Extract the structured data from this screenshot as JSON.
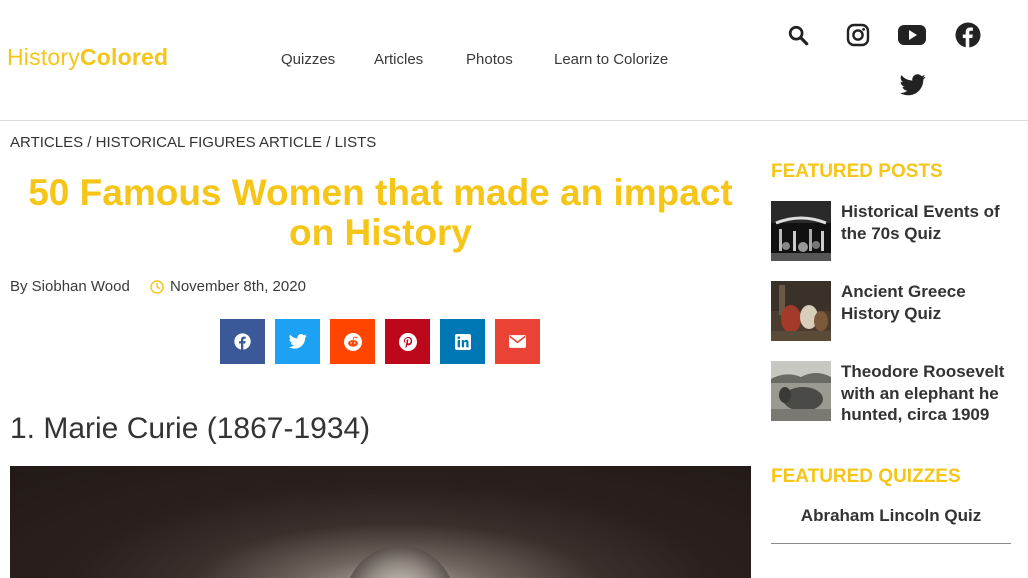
{
  "logo": {
    "part1": "History",
    "part2": "Colored"
  },
  "nav": {
    "items": [
      "Quizzes",
      "Articles",
      "Photos",
      "Learn to Colorize"
    ]
  },
  "header_icons": [
    "search-icon",
    "instagram-icon",
    "youtube-icon",
    "facebook-icon",
    "twitter-icon"
  ],
  "breadcrumb": {
    "items": [
      "Articles",
      "Historical Figures Article",
      "Lists"
    ],
    "separator": " / "
  },
  "article": {
    "title_line1": "50 Famous Women that made an impact",
    "title_line2": "on History",
    "author": "By Siobhan Wood",
    "date": "November 8th, 2020",
    "section_heading": "1. Marie Curie (1867-1934)"
  },
  "share": [
    {
      "icon": "facebook-icon",
      "color": "#3b5998"
    },
    {
      "icon": "twitter-icon",
      "color": "#1da1f2"
    },
    {
      "icon": "reddit-icon",
      "color": "#ff4500"
    },
    {
      "icon": "pinterest-icon",
      "color": "#bd081c"
    },
    {
      "icon": "linkedin-icon",
      "color": "#0077b5"
    },
    {
      "icon": "email-icon",
      "color": "#ea4335"
    }
  ],
  "sidebar": {
    "featured_posts_heading": "FEATURED POSTS",
    "posts": [
      {
        "title": "Historical Events of the 70s Quiz"
      },
      {
        "title": "Ancient Greece History Quiz"
      },
      {
        "title": "Theodore Roosevelt with an elephant he hunted, circa 1909"
      }
    ],
    "featured_quizzes_heading": "FEATURED QUIZZES",
    "quizzes": [
      {
        "title": "Abraham Lincoln Quiz"
      }
    ]
  },
  "colors": {
    "accent": "#f5c518",
    "text": "#3a3a3a"
  }
}
